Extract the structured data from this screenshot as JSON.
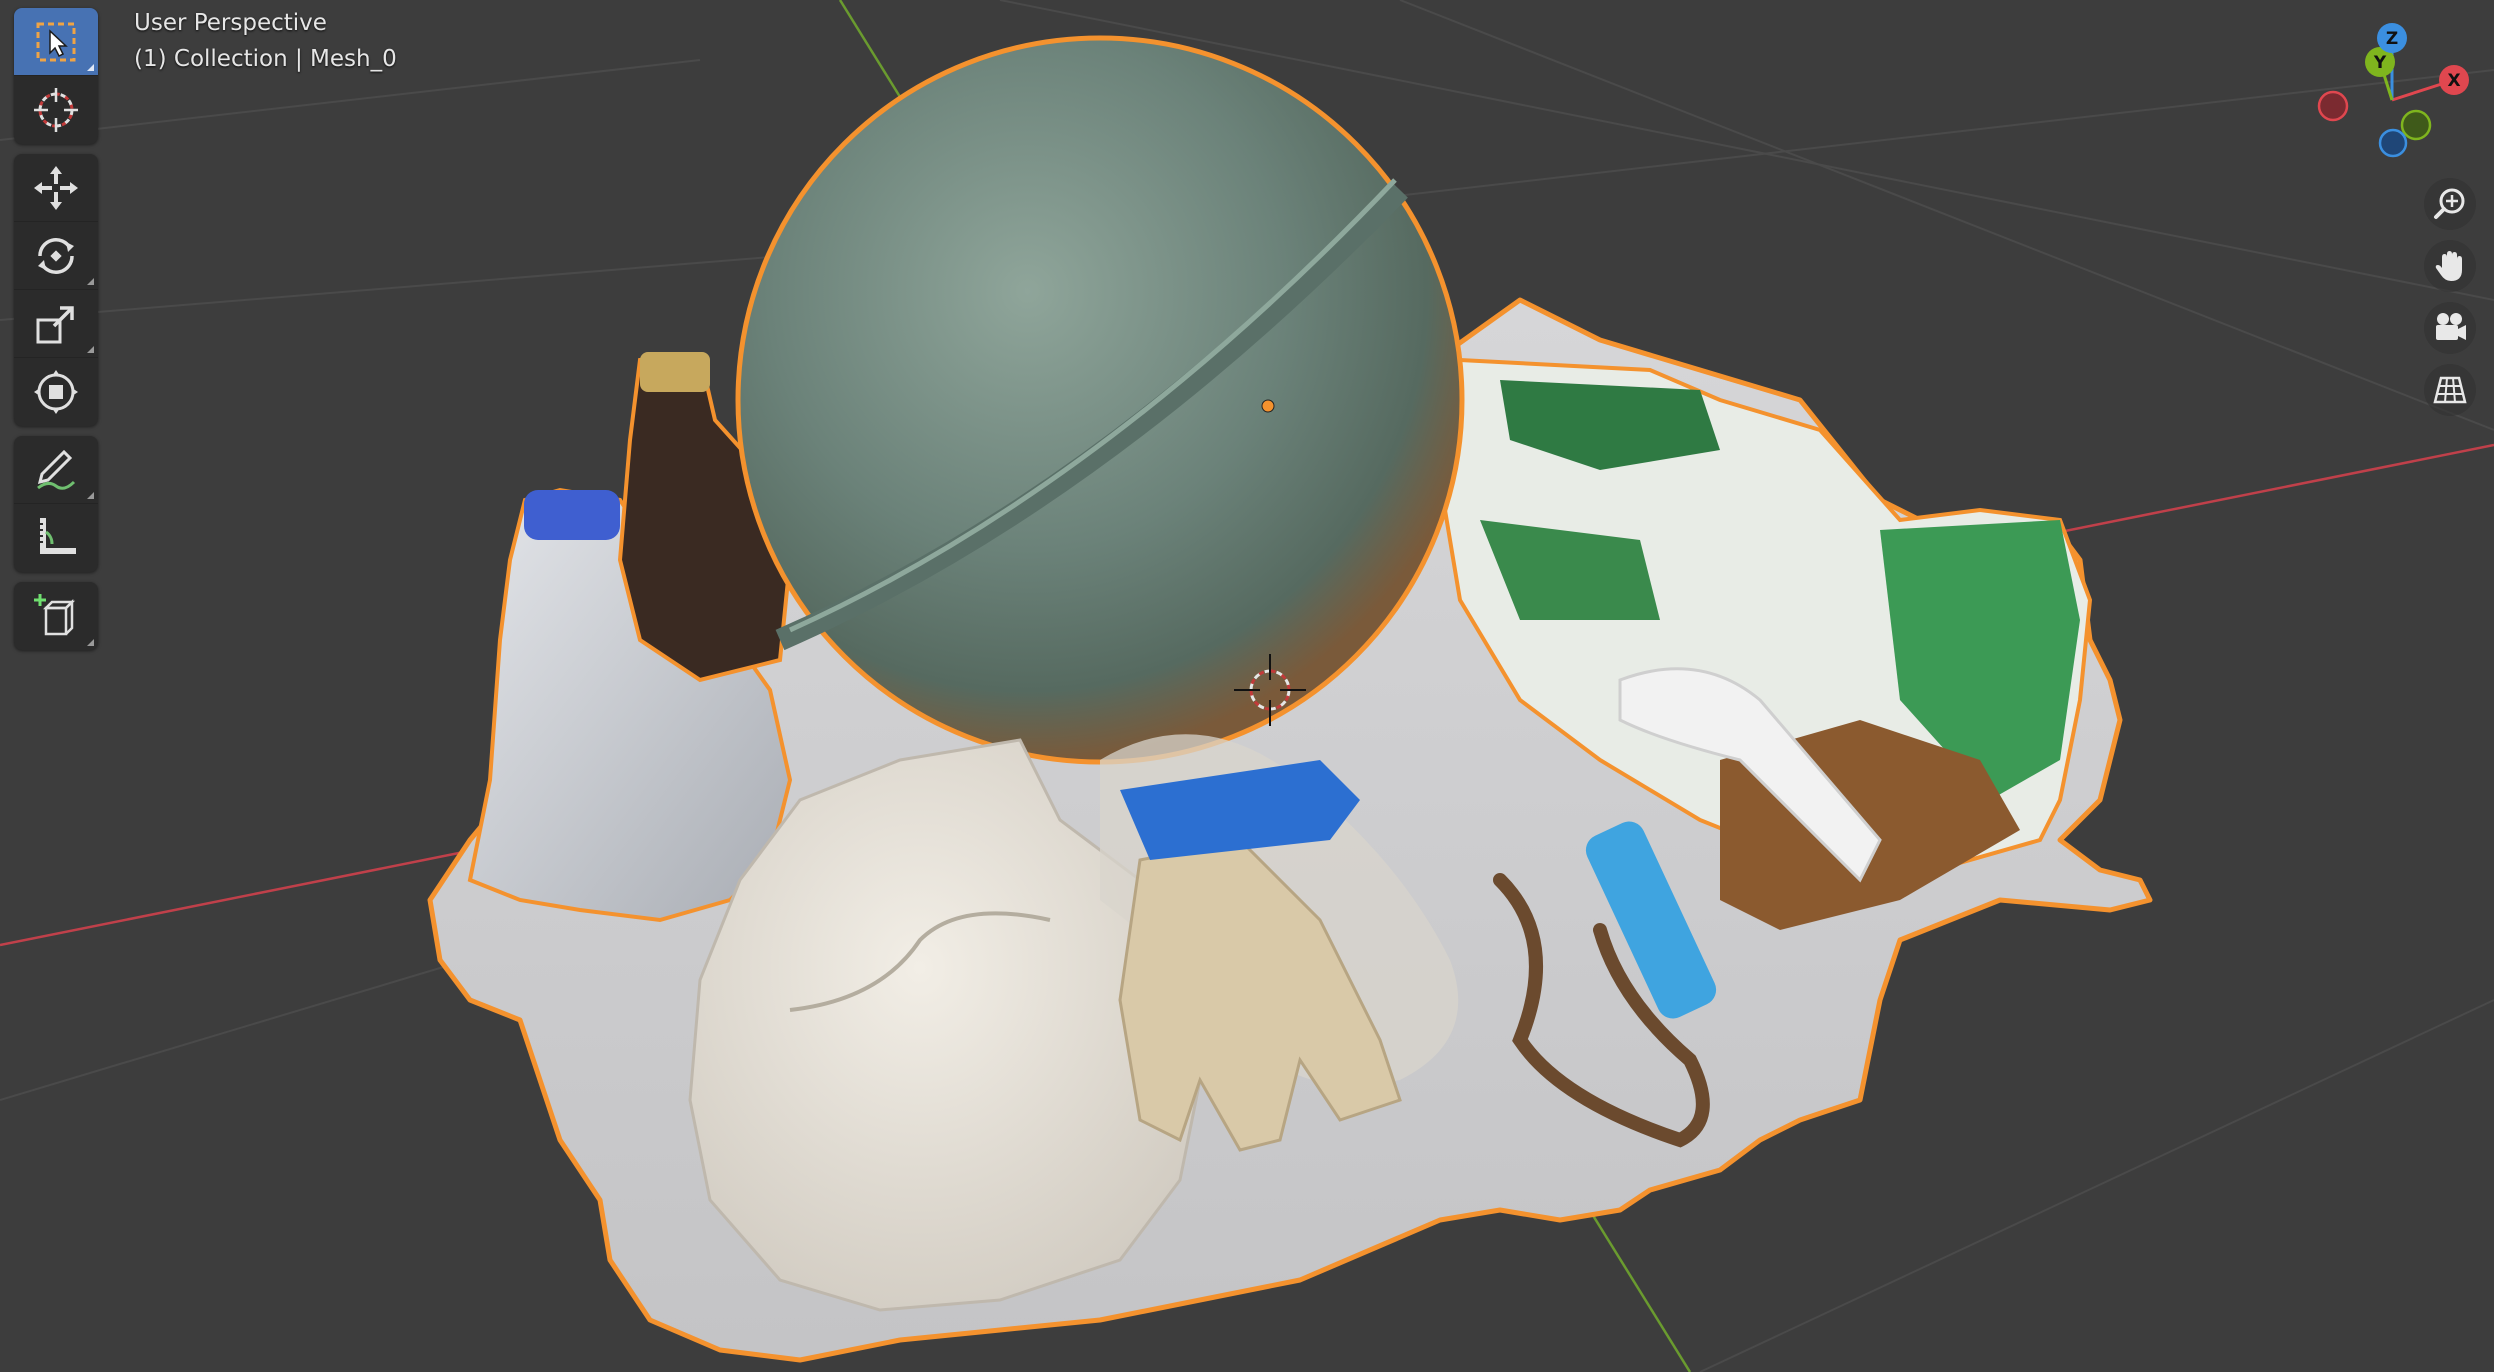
{
  "viewport": {
    "view_name": "User Perspective",
    "collection_info": "(1) Collection | Mesh_0",
    "colors": {
      "background": "#3d3d3d",
      "grid": "#4a4a4a",
      "x_axis": "#c0404a",
      "y_axis": "#6a9b2f",
      "selection_outline": "#f4922e",
      "active_tool": "#4772b3"
    }
  },
  "toolbar": {
    "groups": [
      {
        "tools": [
          {
            "name": "select-box",
            "icon": "select-box-icon",
            "active": true
          },
          {
            "name": "cursor",
            "icon": "cursor-icon"
          }
        ]
      },
      {
        "tools": [
          {
            "name": "move",
            "icon": "move-icon"
          },
          {
            "name": "rotate",
            "icon": "rotate-icon"
          },
          {
            "name": "scale",
            "icon": "scale-icon"
          },
          {
            "name": "transform",
            "icon": "transform-icon"
          }
        ]
      },
      {
        "tools": [
          {
            "name": "annotate",
            "icon": "annotate-icon"
          },
          {
            "name": "measure",
            "icon": "measure-icon"
          }
        ]
      },
      {
        "tools": [
          {
            "name": "add-cube",
            "icon": "add-cube-icon"
          }
        ]
      }
    ]
  },
  "navigation_gizmo": {
    "axes": {
      "x": "X",
      "y": "Y",
      "z": "Z"
    },
    "colors": {
      "x": "#e0474f",
      "y": "#7fb51e",
      "z": "#3b8fe0"
    }
  },
  "navigation_buttons": [
    {
      "name": "zoom",
      "icon": "zoom-in-icon"
    },
    {
      "name": "pan",
      "icon": "hand-icon"
    },
    {
      "name": "camera",
      "icon": "camera-icon"
    },
    {
      "name": "ortho-toggle",
      "icon": "grid-icon"
    }
  ]
}
